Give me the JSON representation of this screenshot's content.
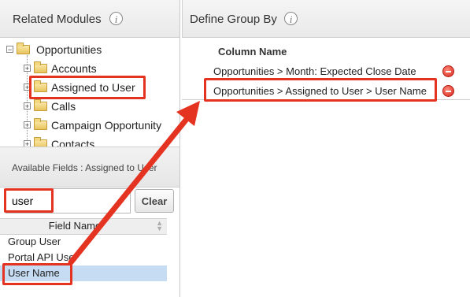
{
  "related_modules": {
    "title": "Related Modules",
    "tree": {
      "root": "Opportunities",
      "items": [
        "Accounts",
        "Assigned to User",
        "Calls",
        "Campaign Opportunity",
        "Contacts"
      ]
    }
  },
  "available_fields": {
    "label": "Available Fields :  Assigned to User",
    "search_value": "user",
    "clear_label": "Clear",
    "column_header": "Field Name",
    "rows": [
      "Group User",
      "Portal API User",
      "User Name"
    ]
  },
  "define_group_by": {
    "title": "Define Group By",
    "column_header": "Column Name",
    "rows": [
      "Opportunities > Month: Expected Close Date",
      "Opportunities > Assigned to User > User Name"
    ]
  },
  "colors": {
    "highlight": "#e53322",
    "selected_row": "#c6dcf3",
    "remove": "#d6261b"
  }
}
